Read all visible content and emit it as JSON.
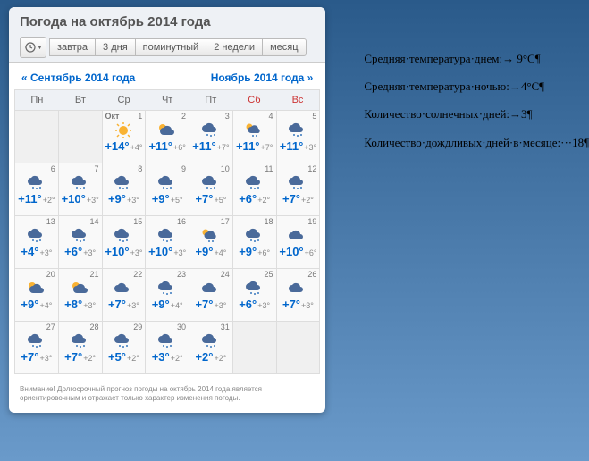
{
  "header": {
    "title": "Погода на октябрь 2014 года",
    "tabs": [
      "завтра",
      "3 дня",
      "поминутный",
      "2 недели",
      "месяц"
    ]
  },
  "nav": {
    "prev": "« Сентябрь 2014 года",
    "next": "Ноябрь 2014 года »"
  },
  "dow": [
    "Пн",
    "Вт",
    "Ср",
    "Чт",
    "Пт",
    "Сб",
    "Вс"
  ],
  "month_label": "Окт",
  "days": [
    {
      "d": 1,
      "ic": "sun",
      "hi": "+14°",
      "lo": "+4°"
    },
    {
      "d": 2,
      "ic": "pc",
      "hi": "+11°",
      "lo": "+6°"
    },
    {
      "d": 3,
      "ic": "rain",
      "hi": "+11°",
      "lo": "+7°"
    },
    {
      "d": 4,
      "ic": "pcr",
      "hi": "+11°",
      "lo": "+7°"
    },
    {
      "d": 5,
      "ic": "rain",
      "hi": "+11°",
      "lo": "+3°"
    },
    {
      "d": 6,
      "ic": "rain",
      "hi": "+11°",
      "lo": "+2°"
    },
    {
      "d": 7,
      "ic": "rain",
      "hi": "+10°",
      "lo": "+3°"
    },
    {
      "d": 8,
      "ic": "rain",
      "hi": "+9°",
      "lo": "+3°"
    },
    {
      "d": 9,
      "ic": "rain",
      "hi": "+9°",
      "lo": "+5°"
    },
    {
      "d": 10,
      "ic": "rain",
      "hi": "+7°",
      "lo": "+5°"
    },
    {
      "d": 11,
      "ic": "rain",
      "hi": "+6°",
      "lo": "+2°"
    },
    {
      "d": 12,
      "ic": "rain",
      "hi": "+7°",
      "lo": "+2°"
    },
    {
      "d": 13,
      "ic": "rain",
      "hi": "+4°",
      "lo": "+3°"
    },
    {
      "d": 14,
      "ic": "rain",
      "hi": "+6°",
      "lo": "+3°"
    },
    {
      "d": 15,
      "ic": "rain",
      "hi": "+10°",
      "lo": "+3°"
    },
    {
      "d": 16,
      "ic": "rain",
      "hi": "+10°",
      "lo": "+3°"
    },
    {
      "d": 17,
      "ic": "pcr",
      "hi": "+9°",
      "lo": "+4°"
    },
    {
      "d": 18,
      "ic": "rain",
      "hi": "+9°",
      "lo": "+6°"
    },
    {
      "d": 19,
      "ic": "cloud",
      "hi": "+10°",
      "lo": "+6°"
    },
    {
      "d": 20,
      "ic": "pc",
      "hi": "+9°",
      "lo": "+4°"
    },
    {
      "d": 21,
      "ic": "pc",
      "hi": "+8°",
      "lo": "+3°"
    },
    {
      "d": 22,
      "ic": "cloud",
      "hi": "+7°",
      "lo": "+3°"
    },
    {
      "d": 23,
      "ic": "rain",
      "hi": "+9°",
      "lo": "+4°"
    },
    {
      "d": 24,
      "ic": "cloud",
      "hi": "+7°",
      "lo": "+3°"
    },
    {
      "d": 25,
      "ic": "rain",
      "hi": "+6°",
      "lo": "+3°"
    },
    {
      "d": 26,
      "ic": "cloud",
      "hi": "+7°",
      "lo": "+3°"
    },
    {
      "d": 27,
      "ic": "rain",
      "hi": "+7°",
      "lo": "+3°"
    },
    {
      "d": 28,
      "ic": "rain",
      "hi": "+7°",
      "lo": "+2°"
    },
    {
      "d": 29,
      "ic": "rain",
      "hi": "+5°",
      "lo": "+2°"
    },
    {
      "d": 30,
      "ic": "rain",
      "hi": "+3°",
      "lo": "+2°"
    },
    {
      "d": 31,
      "ic": "rain",
      "hi": "+2°",
      "lo": "+2°"
    }
  ],
  "footnote": "Внимание! Долгосрочный прогноз погоды на октябрь 2014 года является ориентировочным и отражает только характер изменения погоды.",
  "side": [
    "Средняя·температура·днем:→ 9°С¶",
    "Средняя·температура·ночью:→4°С¶",
    "Количество·солнечных·дней:→3¶",
    "Количество·дождливых·дней·в·месяце:···18¶"
  ],
  "chart_data": {
    "type": "table",
    "title": "Погода на октябрь 2014 года",
    "columns": [
      "day",
      "condition",
      "high_c",
      "low_c"
    ],
    "rows": [
      [
        1,
        "sun",
        14,
        4
      ],
      [
        2,
        "partly_cloudy",
        11,
        6
      ],
      [
        3,
        "rain",
        11,
        7
      ],
      [
        4,
        "partly_cloudy_rain",
        11,
        7
      ],
      [
        5,
        "rain",
        11,
        3
      ],
      [
        6,
        "rain",
        11,
        2
      ],
      [
        7,
        "rain",
        10,
        3
      ],
      [
        8,
        "rain",
        9,
        3
      ],
      [
        9,
        "rain",
        9,
        5
      ],
      [
        10,
        "rain",
        7,
        5
      ],
      [
        11,
        "rain",
        6,
        2
      ],
      [
        12,
        "rain",
        7,
        2
      ],
      [
        13,
        "rain",
        4,
        3
      ],
      [
        14,
        "rain",
        6,
        3
      ],
      [
        15,
        "rain",
        10,
        3
      ],
      [
        16,
        "rain",
        10,
        3
      ],
      [
        17,
        "partly_cloudy_rain",
        9,
        4
      ],
      [
        18,
        "rain",
        9,
        6
      ],
      [
        19,
        "cloudy",
        10,
        6
      ],
      [
        20,
        "partly_cloudy",
        9,
        4
      ],
      [
        21,
        "partly_cloudy",
        8,
        3
      ],
      [
        22,
        "cloudy",
        7,
        3
      ],
      [
        23,
        "rain",
        9,
        4
      ],
      [
        24,
        "cloudy",
        7,
        3
      ],
      [
        25,
        "rain",
        6,
        3
      ],
      [
        26,
        "cloudy",
        7,
        3
      ],
      [
        27,
        "rain",
        7,
        3
      ],
      [
        28,
        "rain",
        7,
        2
      ],
      [
        29,
        "rain",
        5,
        2
      ],
      [
        30,
        "rain",
        3,
        2
      ],
      [
        31,
        "rain",
        2,
        2
      ]
    ],
    "summary": {
      "avg_day_c": 9,
      "avg_night_c": 4,
      "sunny_days": 3,
      "rainy_days": 18
    }
  }
}
